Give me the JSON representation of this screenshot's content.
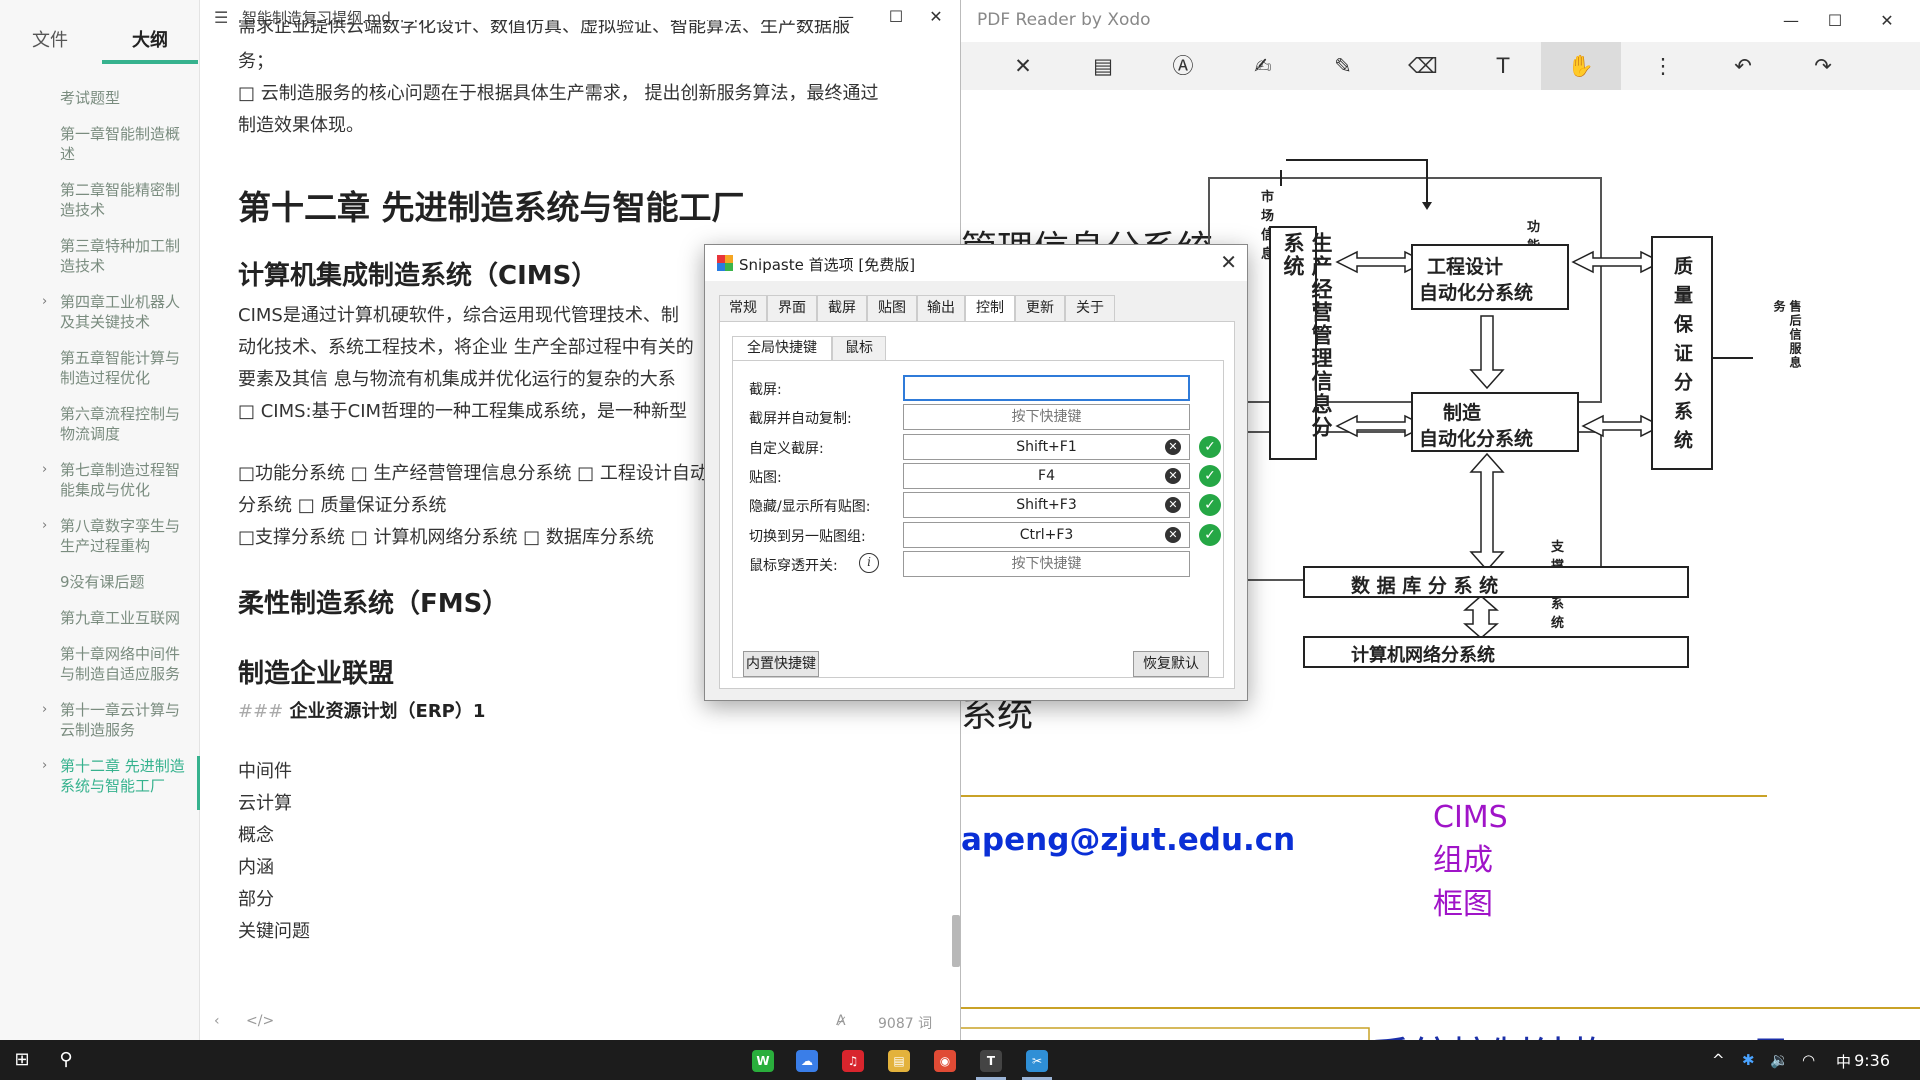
{
  "typora": {
    "tabs": {
      "file": "文件",
      "outline": "大纲"
    },
    "outline": [
      {
        "label": "考试题型",
        "caret": false,
        "active": false
      },
      {
        "label": "第一章智能制造概述",
        "caret": false,
        "active": false
      },
      {
        "label": "第二章智能精密制造技术",
        "caret": false,
        "active": false
      },
      {
        "label": "第三章特种加工制造技术",
        "caret": false,
        "active": false
      },
      {
        "label": "第四章工业机器人及其关键技术",
        "caret": true,
        "active": false
      },
      {
        "label": "第五章智能计算与制造过程优化",
        "caret": false,
        "active": false
      },
      {
        "label": "第六章流程控制与物流调度",
        "caret": false,
        "active": false
      },
      {
        "label": "第七章制造过程智能集成与优化",
        "caret": true,
        "active": false
      },
      {
        "label": "第八章数字孪生与生产过程重构",
        "caret": true,
        "active": false
      },
      {
        "label": "9没有课后题",
        "caret": false,
        "active": false
      },
      {
        "label": "第九章工业互联网",
        "caret": false,
        "active": false
      },
      {
        "label": "第十章网络中间件与制造自适应服务",
        "caret": false,
        "active": false
      },
      {
        "label": "第十一章云计算与云制造服务",
        "caret": true,
        "active": false
      },
      {
        "label": "第十二章 先进制造系统与智能工厂",
        "caret": true,
        "active": true
      }
    ],
    "caret_glyph": "›",
    "file_title": "智能制造复习提纲.md",
    "content": {
      "p_top1": "需求企业提供云端数字化设计、数值仿真、虚拟验证、智能算法、生产数据服",
      "p_top2": "务；",
      "p_top3": "□ 云制造服务的核心问题在于根据具体生产需求， 提出创新服务算法，最终通过",
      "p_top4": "制造效果体现。",
      "h1": "第十二章 先进制造系统与智能工厂",
      "h2_cims": "计算机集成制造系统（CIMS）",
      "cims_p1": "CIMS是通过计算机硬软件，综合运用现代管理技术、制",
      "cims_p2": "动化技术、系统工程技术，将企业 生产全部过程中有关的",
      "cims_p3": "要素及其信 息与物流有机集成并优化运行的复杂的大系",
      "cims_p4": "□ CIMS:基于CIM哲理的一种工程集成系统，是一种新型",
      "sub_p1": "□功能分系统 □ 生产经营管理信息分系统 □ 工程设计自动",
      "sub_p2": "分系统 □ 质量保证分系统",
      "sub_p3": "□支撑分系统 □ 计算机网络分系统 □ 数据库分系统",
      "h2_fms": "柔性制造系统（FMS）",
      "h2_alliance": "制造企业联盟",
      "h4_hash": "###",
      "h4_erp": "企业资源计划（ERP）1",
      "list": [
        "中间件",
        "云计算",
        "概念",
        "内涵",
        "部分",
        "关键问题"
      ]
    },
    "word_count": "9087 词"
  },
  "pdf": {
    "title": "PDF Reader by Xodo",
    "toolbar_icons": [
      "close-icon",
      "comment-icon",
      "text-highlight-icon",
      "signature-icon",
      "pen-icon",
      "eraser-icon",
      "text-icon",
      "pan-hand-icon",
      "more-icon",
      "undo-icon",
      "redo-icon"
    ],
    "toolbar_glyphs": [
      "✕",
      "▤",
      "Ⓐ",
      "✍",
      "✎",
      "⌫",
      "T",
      "✋",
      "⋮",
      "↶",
      "↷"
    ],
    "bg_text_top": "管理信息分系统",
    "bg_text_mid": "系统",
    "email": "apeng@zjut.edu.cn",
    "bottom_text": "系统控制结构—CIMS显",
    "diagram": {
      "market_info": "市场信息",
      "functional": "功能分系统",
      "management": "生产经营管理信息分系统",
      "engineering_1": "工程设计",
      "engineering_2": "自动化分系统",
      "quality": "质量保证分系统",
      "manufacturing_1": "制造",
      "manufacturing_2": "自动化分系统",
      "after_sales": "售后信服息务",
      "support": "支撑分系统",
      "database": "数 据 库 分 系 统",
      "network": "计算机网络分系统",
      "caption": "CIMS组成框图"
    }
  },
  "snipaste": {
    "title": "Snipaste 首选项 [免费版]",
    "tabs": [
      "常规",
      "界面",
      "截屏",
      "贴图",
      "输出",
      "控制",
      "更新",
      "关于"
    ],
    "active_tab": "控制",
    "subtabs": [
      "全局快捷键",
      "鼠标"
    ],
    "rows": [
      {
        "label": "截屏:",
        "value": "",
        "focus": true,
        "clear": false,
        "ok": false
      },
      {
        "label": "截屏并自动复制:",
        "value": "按下快捷键",
        "empty": true,
        "clear": false,
        "ok": false
      },
      {
        "label": "自定义截屏:",
        "value": "Shift+F1",
        "clear": true,
        "ok": true
      },
      {
        "label": "贴图:",
        "value": "F4",
        "clear": true,
        "ok": true
      },
      {
        "label": "隐藏/显示所有贴图:",
        "value": "Shift+F3",
        "clear": true,
        "ok": true
      },
      {
        "label": "切换到另一贴图组:",
        "value": "Ctrl+F3",
        "clear": true,
        "ok": true
      },
      {
        "label": "鼠标穿透开关:",
        "value": "按下快捷键",
        "empty": true,
        "info": true,
        "clear": false,
        "ok": false
      }
    ],
    "btn_builtin": "内置快捷键",
    "btn_reset": "恢复默认"
  },
  "taskbar": {
    "time": "9:36",
    "ime": "中",
    "app_icons": [
      "wechat-icon",
      "baidu-netdisk-icon",
      "netease-music-icon",
      "file-explorer-icon",
      "chrome-icon",
      "typora-icon",
      "snipaste-icon"
    ]
  },
  "colors": {
    "accent": "#36b28e",
    "email": "#0a2fd6",
    "caption": "#a014c8"
  }
}
